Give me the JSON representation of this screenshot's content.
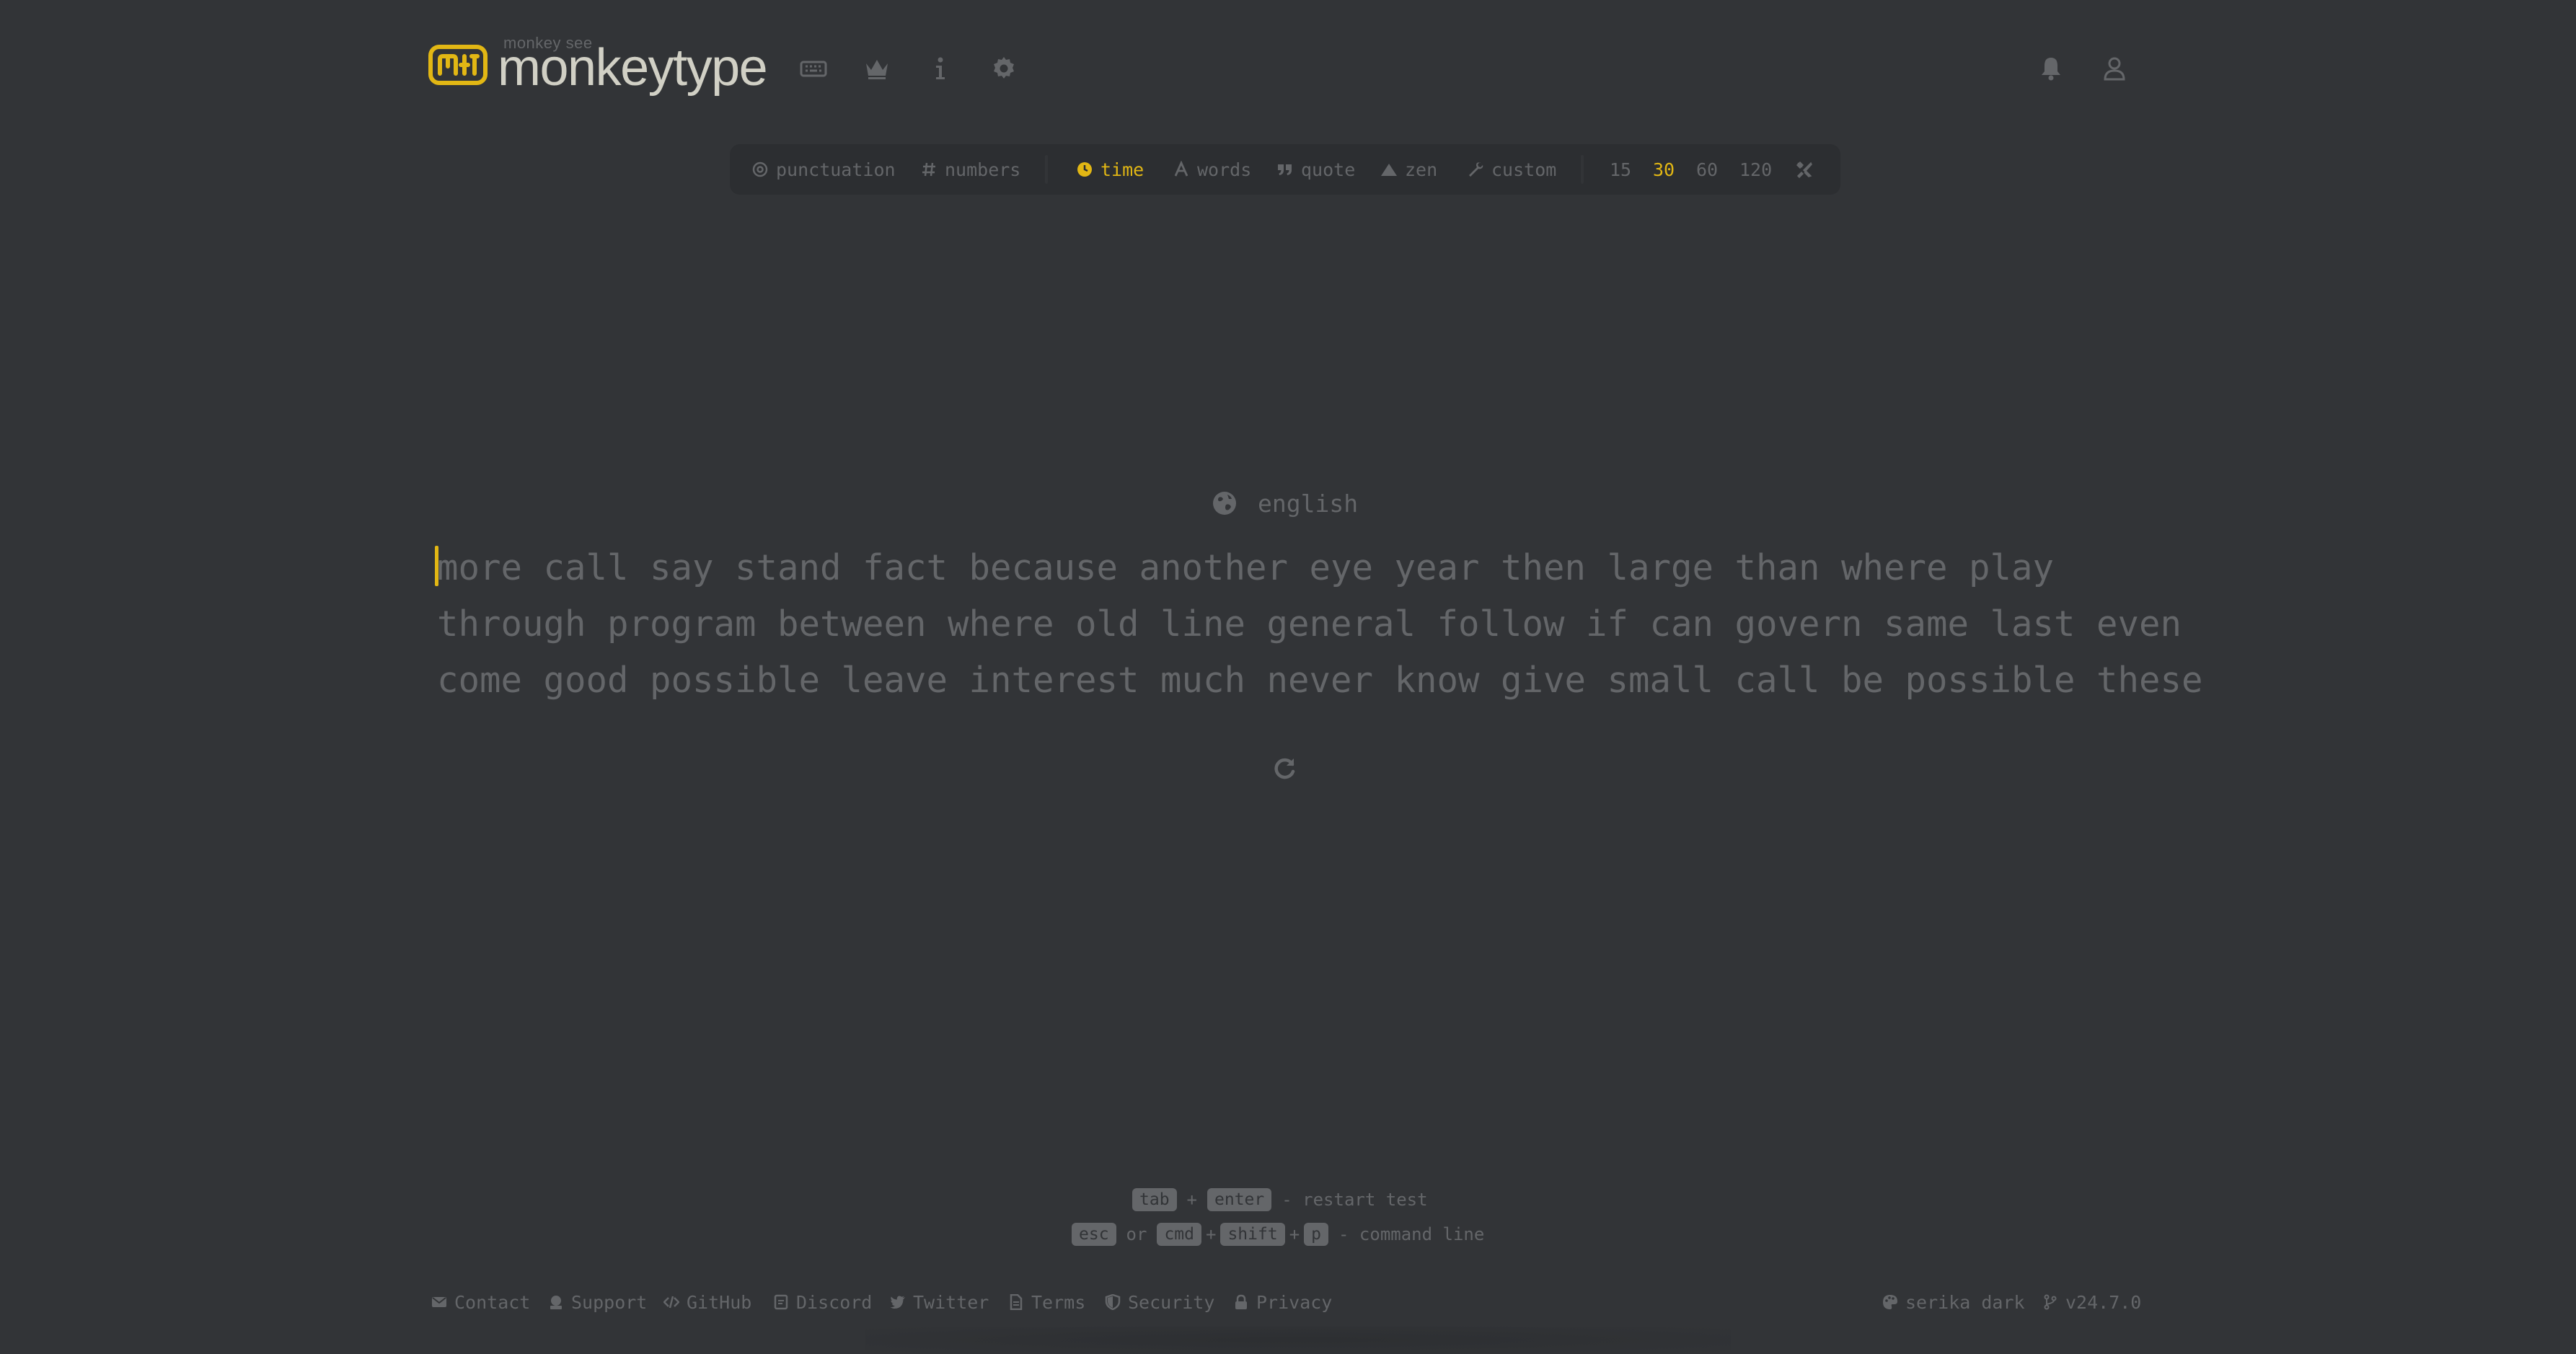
{
  "colors": {
    "background": "#323437",
    "sub": "#646669",
    "text": "#d1d0c5",
    "accent": "#e2b714",
    "sub_alt": "#2c2e31"
  },
  "header": {
    "logo_top_text": "monkey see",
    "logo_text": "monkeytype",
    "nav_icons": [
      "keyboard-icon",
      "crown-icon",
      "info-icon",
      "gear-icon"
    ],
    "right_icons": [
      "bell-icon",
      "user-icon"
    ]
  },
  "config": {
    "toggles": [
      {
        "label": "punctuation",
        "icon": "at-icon",
        "active": false
      },
      {
        "label": "numbers",
        "icon": "hash-icon",
        "active": false
      }
    ],
    "modes": [
      {
        "label": "time",
        "icon": "clock-icon",
        "active": true
      },
      {
        "label": "words",
        "icon": "font-icon",
        "active": false
      },
      {
        "label": "quote",
        "icon": "quote-icon",
        "active": false
      },
      {
        "label": "zen",
        "icon": "mountain-icon",
        "active": false
      },
      {
        "label": "custom",
        "icon": "wrench-icon",
        "active": false
      }
    ],
    "durations": [
      {
        "label": "15",
        "active": false
      },
      {
        "label": "30",
        "active": true
      },
      {
        "label": "60",
        "active": false
      },
      {
        "label": "120",
        "active": false
      }
    ],
    "custom_duration_icon": "tools-icon"
  },
  "test": {
    "language": "english",
    "lines": [
      "more call say stand fact because another eye year then large than where play",
      "through program between where old line general follow if can govern same last even",
      "come good possible leave interest much never know give small call be possible these"
    ],
    "restart_icon": "redo-icon"
  },
  "hints": {
    "line1": {
      "keys": [
        "tab",
        "enter"
      ],
      "joiners": [
        "+"
      ],
      "text": "- restart test"
    },
    "line2": {
      "keys": [
        "esc",
        "cmd",
        "shift",
        "p"
      ],
      "or": "or",
      "joiners": [
        "+",
        "+"
      ],
      "text": "- command line"
    }
  },
  "footer": {
    "links": [
      {
        "label": "Contact",
        "icon": "envelope-icon"
      },
      {
        "label": "Support",
        "icon": "donate-icon"
      },
      {
        "label": "GitHub",
        "icon": "code-icon"
      },
      {
        "label": "Discord",
        "icon": "discord-icon"
      },
      {
        "label": "Twitter",
        "icon": "twitter-icon"
      },
      {
        "label": "Terms",
        "icon": "file-icon"
      },
      {
        "label": "Security",
        "icon": "shield-icon"
      },
      {
        "label": "Privacy",
        "icon": "lock-icon"
      }
    ],
    "theme": {
      "label": "serika dark",
      "icon": "palette-icon"
    },
    "version": {
      "label": "v24.7.0",
      "icon": "code-branch-icon"
    }
  }
}
